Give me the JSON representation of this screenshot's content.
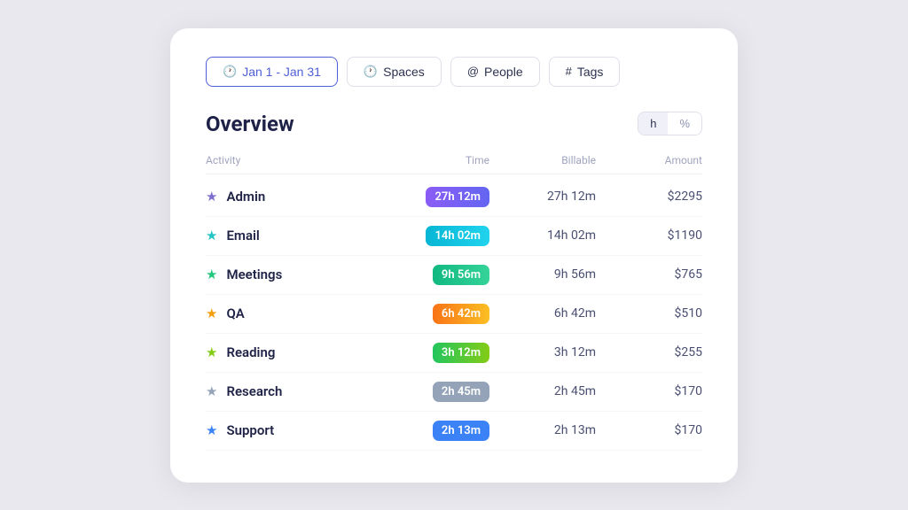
{
  "filters": [
    {
      "id": "date",
      "label": "Jan 1 - Jan 31",
      "icon": "🕐",
      "active": true
    },
    {
      "id": "spaces",
      "label": "Spaces",
      "icon": "🕐",
      "active": false
    },
    {
      "id": "people",
      "label": "People",
      "icon": "@",
      "active": false
    },
    {
      "id": "tags",
      "label": "Tags",
      "icon": "#",
      "active": false
    }
  ],
  "overview": {
    "title": "Overview",
    "toggle": {
      "h_label": "h",
      "percent_label": "%",
      "active": "h"
    }
  },
  "table": {
    "headers": {
      "activity": "Activity",
      "time": "Time",
      "billable": "Billable",
      "amount": "Amount"
    },
    "rows": [
      {
        "name": "Admin",
        "star_color": "#7c6fcd",
        "badge_color": "linear-gradient(90deg, #8b5cf6, #6366f1)",
        "time": "27h 12m",
        "billable": "27h 12m",
        "amount": "$2295"
      },
      {
        "name": "Email",
        "star_color": "#22c4c4",
        "badge_color": "linear-gradient(90deg, #06b6d4, #22d3ee)",
        "time": "14h 02m",
        "billable": "14h 02m",
        "amount": "$1190"
      },
      {
        "name": "Meetings",
        "star_color": "#22c77d",
        "badge_color": "linear-gradient(90deg, #10b981, #34d399)",
        "time": "9h 56m",
        "billable": "9h 56m",
        "amount": "$765"
      },
      {
        "name": "QA",
        "star_color": "#f59e0b",
        "badge_color": "linear-gradient(90deg, #f97316, #fbbf24)",
        "time": "6h 42m",
        "billable": "6h 42m",
        "amount": "$510"
      },
      {
        "name": "Reading",
        "star_color": "#84cc16",
        "badge_color": "linear-gradient(90deg, #22c55e, #84cc16)",
        "time": "3h 12m",
        "billable": "3h 12m",
        "amount": "$255"
      },
      {
        "name": "Research",
        "star_color": "#94a3b8",
        "badge_color": "#94a3b8",
        "time": "2h 45m",
        "billable": "2h 45m",
        "amount": "$170"
      },
      {
        "name": "Support",
        "star_color": "#3b82f6",
        "badge_color": "#3b82f6",
        "time": "2h 13m",
        "billable": "2h 13m",
        "amount": "$170"
      }
    ]
  }
}
